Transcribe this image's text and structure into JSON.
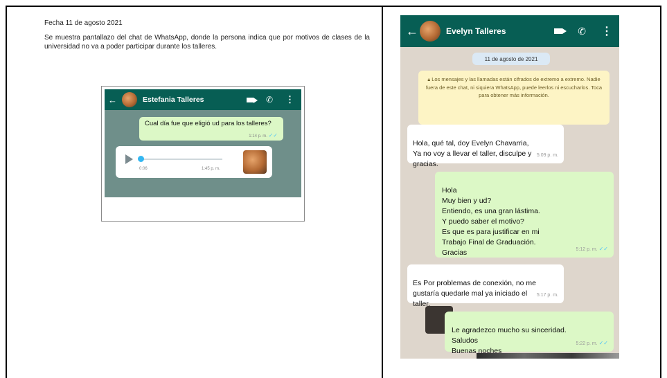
{
  "document": {
    "date_line": "Fecha 11 de agosto 2021",
    "description": "Se muestra pantallazo del chat de WhatsApp, donde la persona indica que por motivos de clases de la universidad no va a poder participar durante los talleres."
  },
  "small_screenshot": {
    "contact_name": "Estefania Talleres",
    "message": "Cual día fue que eligió ud para los talleres?",
    "message_time": "1:14 p. m.",
    "audio_duration": "0:06",
    "audio_time": "1:45 p. m."
  },
  "phone_screenshot": {
    "contact_name": "Evelyn Talleres",
    "date_pill": "11 de agosto de 2021",
    "encryption_notice": "Los mensajes y las llamadas están cifrados de extremo a extremo. Nadie fuera de este chat, ni siquiera WhatsApp, puede leerlos ni escucharlos. Toca para obtener más información.",
    "messages": [
      {
        "direction": "in",
        "text": "Hola, qué tal, doy Evelyn Chavarria,\nYa no voy a llevar el taller, disculpe y\ngracias.",
        "time": "5:09 p. m."
      },
      {
        "direction": "out",
        "text": "Hola\nMuy bien y ud?\nEntiendo, es una gran lástima.\nY puedo saber el motivo?\nEs que es para justificar en mi\nTrabajo Final de Graduación.\nGracias",
        "time": "5:12 p. m."
      },
      {
        "direction": "in",
        "text": "Es Por problemas de conexión, no me\ngustaría quedarle mal ya iniciado el\ntaller.",
        "time": "5:17 p. m."
      },
      {
        "direction": "out",
        "text": "Le agradezco mucho su sinceridad.\nSaludos\nBuenas noches",
        "time": "5:22 p. m."
      }
    ]
  },
  "icons": [
    "back-arrow-icon",
    "video-call-icon",
    "phone-call-icon",
    "more-options-icon",
    "play-icon",
    "lock-icon",
    "double-check-icon"
  ],
  "colors": {
    "whatsapp_header": "#075e54",
    "outgoing_bubble": "#dcf8c6",
    "incoming_bubble": "#ffffff",
    "chat_background": "#ded6cc"
  }
}
